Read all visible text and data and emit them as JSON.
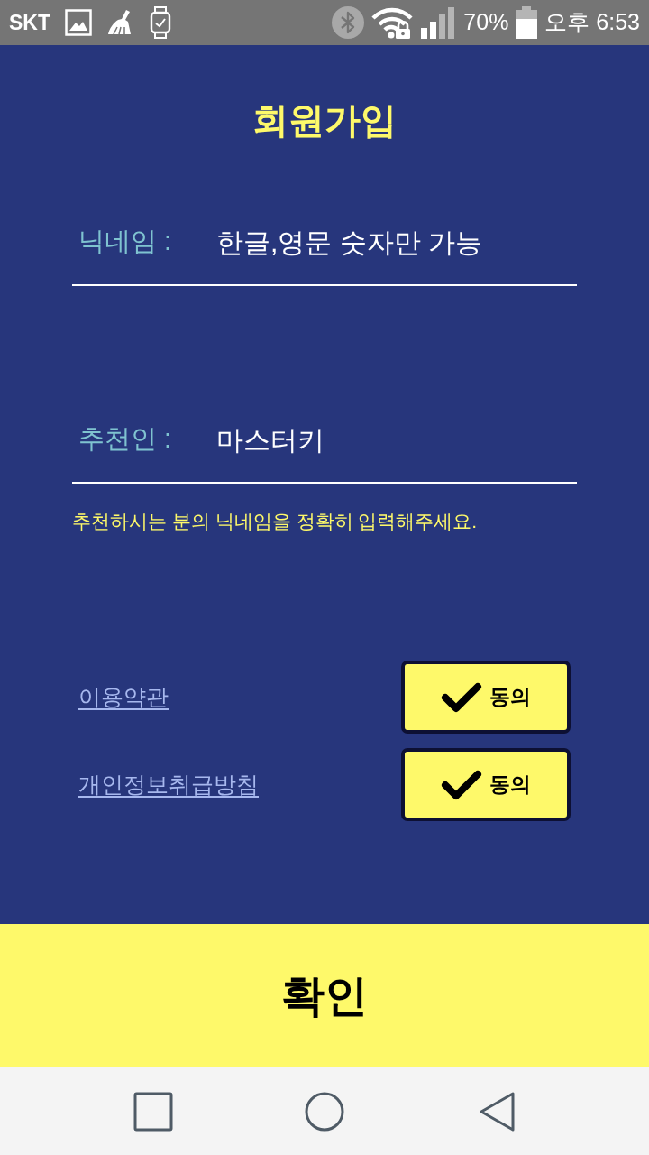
{
  "status_bar": {
    "carrier": "SKT",
    "battery": "70%",
    "time": "오후 6:53"
  },
  "title": "회원가입",
  "fields": [
    {
      "label": "닉네임 :",
      "placeholder": "한글,영문 숫자만 가능"
    },
    {
      "label": "추천인 :",
      "value": "마스터키",
      "hint": "추천하시는 분의 닉네임을 정확히 입력해주세요."
    }
  ],
  "agreements": [
    {
      "label": "이용약관",
      "button": "동의",
      "checked": true
    },
    {
      "label": "개인정보취급방침",
      "button": "동의",
      "checked": true
    }
  ],
  "confirm_button": "확인"
}
